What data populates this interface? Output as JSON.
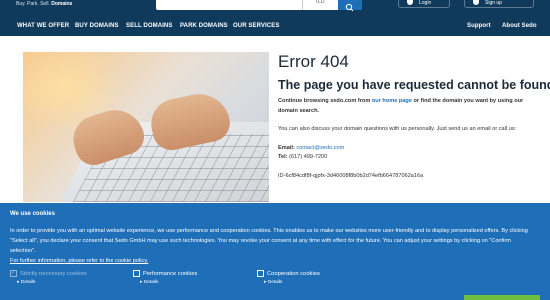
{
  "header": {
    "tagline": [
      "Buy.",
      "Park.",
      "Sell.",
      "Domains"
    ],
    "tld_value": "TLD",
    "login_label": "Login",
    "register_label": "Sign up"
  },
  "nav": {
    "left": [
      "WHAT WE OFFER",
      "BUY DOMAINS",
      "SELL DOMAINS",
      "PARK DOMAINS",
      "OUR SERVICES"
    ],
    "right": [
      "Support",
      "About Sedo"
    ]
  },
  "error": {
    "title": "Error 404",
    "subtitle": "The page you have requested cannot be found.",
    "continue_prefix": "Continue browsing sedo.com from ",
    "home_link": "our home page",
    "continue_suffix": " or find the domain you want by using our domain search.",
    "discuss": "You can also discuss your domain questions with us personally. Just send us an email or call us:",
    "email_label": "Email:",
    "email": "contact@sedo.com",
    "tel_label": "Tel:",
    "tel": "(617) 499-7200",
    "id": "ID-6cf84cdf8f-qjpfx-3d46008f8b0b2d74efb664787062a16a"
  },
  "cookie": {
    "title": "We use cookies",
    "text": "In order to provide you with an optimal website experience, we use performance and cooperation cookies. This enables us to make our websites more user-friendly and to display personalized offers. By clicking \"Select all\", you declare your consent that Sedo GmbH may use such technologies. You may revoke your consent at any time with effect for the future. You can adjust your settings by clicking on \"Confirm selection\".",
    "policy": "For further information, please refer to the cookie policy.",
    "options": [
      {
        "label": "Strictly necessary cookies",
        "checked": true,
        "disabled": true
      },
      {
        "label": "Performance cookies",
        "checked": false,
        "disabled": false
      },
      {
        "label": "Cooperation cookies",
        "checked": false,
        "disabled": false
      }
    ],
    "details_label": "▸ Details"
  },
  "colors": {
    "header_bg": "#103a5c",
    "accent_blue": "#1f6eb8",
    "cookie_bg": "#1f6eb8",
    "accept_green": "#6fbf3f"
  },
  "icons": [
    "search-icon",
    "user-icon"
  ]
}
